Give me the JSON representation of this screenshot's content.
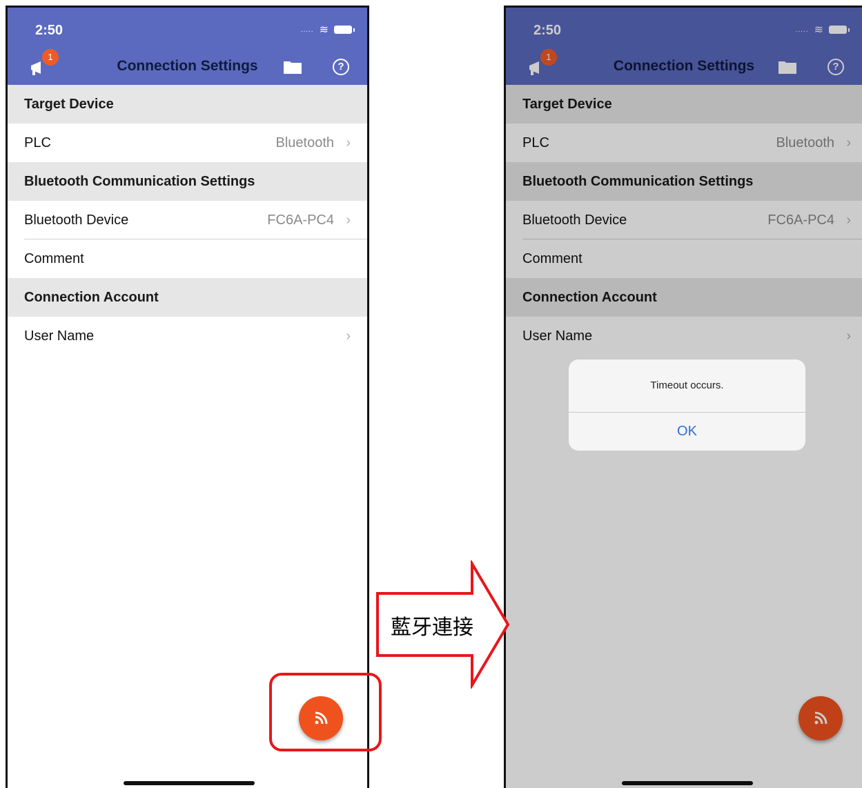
{
  "status_bar": {
    "time": "2:50"
  },
  "header": {
    "badge_count": "1",
    "title": "Connection Settings"
  },
  "sections": {
    "target_device": "Target Device",
    "bluetooth_settings": "Bluetooth Communication Settings",
    "connection_account": "Connection Account"
  },
  "rows": {
    "plc": {
      "label": "PLC",
      "value": "Bluetooth"
    },
    "bluetooth_device": {
      "label": "Bluetooth Device",
      "value": "FC6A-PC4"
    },
    "comment": {
      "label": "Comment"
    },
    "user_name": {
      "label": "User Name"
    }
  },
  "alert": {
    "message": "Timeout occurs.",
    "ok_label": "OK"
  },
  "annotation": {
    "arrow_label": "藍牙連接"
  },
  "icons": {
    "chevron": "›",
    "help": "?",
    "connect": "rss-icon",
    "announcement": "megaphone-icon",
    "folder": "folder-icon"
  },
  "colors": {
    "header": "#5b6abf",
    "fab": "#f0521d",
    "highlight": "#e8161a",
    "badge": "#f05a28"
  }
}
